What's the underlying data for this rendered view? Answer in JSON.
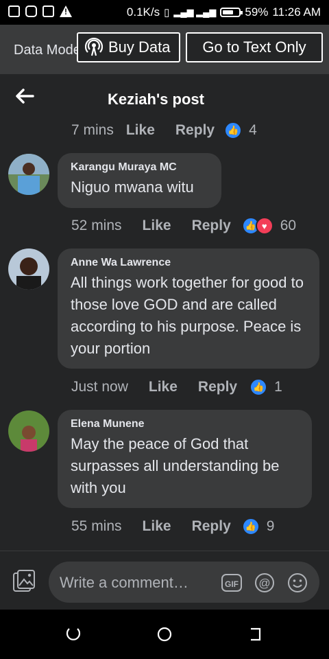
{
  "status_bar": {
    "speed": "0.1K/s",
    "battery": "59%",
    "time": "11:26 AM"
  },
  "banner": {
    "data_mode_label": "Data Mode",
    "buy_data_label": "Buy Data",
    "text_only_label": "Go to Text Only"
  },
  "header": {
    "title": "Keziah's post"
  },
  "top_meta": {
    "time": "7 mins",
    "like": "Like",
    "reply": "Reply",
    "count": "4"
  },
  "comments": [
    {
      "name": "Karangu Muraya MC",
      "body": "Niguo mwana witu",
      "time": "52 mins",
      "like": "Like",
      "reply": "Reply",
      "count": "60"
    },
    {
      "name": "Anne Wa Lawrence",
      "body": "All things work together for good to those love GOD and are called according to his purpose. Peace is your portion",
      "time": "Just now",
      "like": "Like",
      "reply": "Reply",
      "count": "1"
    },
    {
      "name": "Elena Munene",
      "body": "May the peace of God that surpasses all understanding be with you",
      "time": "55 mins",
      "like": "Like",
      "reply": "Reply",
      "count": "9"
    }
  ],
  "composer": {
    "placeholder": "Write a comment…"
  },
  "colors": {
    "accent": "#2d88ff",
    "love": "#f33e58",
    "bubble": "#3a3b3c",
    "background": "#242526"
  }
}
